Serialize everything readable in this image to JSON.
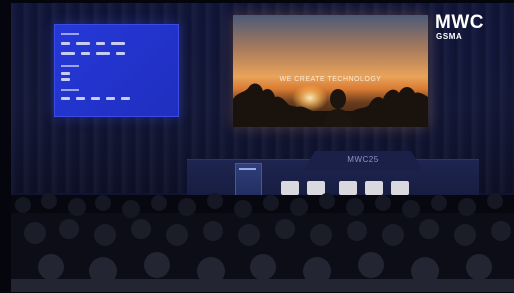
{
  "screen_text": "WE CREATE TECHNOLOGY",
  "logo": {
    "main": "MWC",
    "sub": "GSMA"
  },
  "stage_sign": "MWC25",
  "colors": {
    "left_screen": "#2638d8",
    "curtain": "#11163a",
    "stage": "#1e2550"
  },
  "icons": [
    "mwc-gsma-logo"
  ]
}
